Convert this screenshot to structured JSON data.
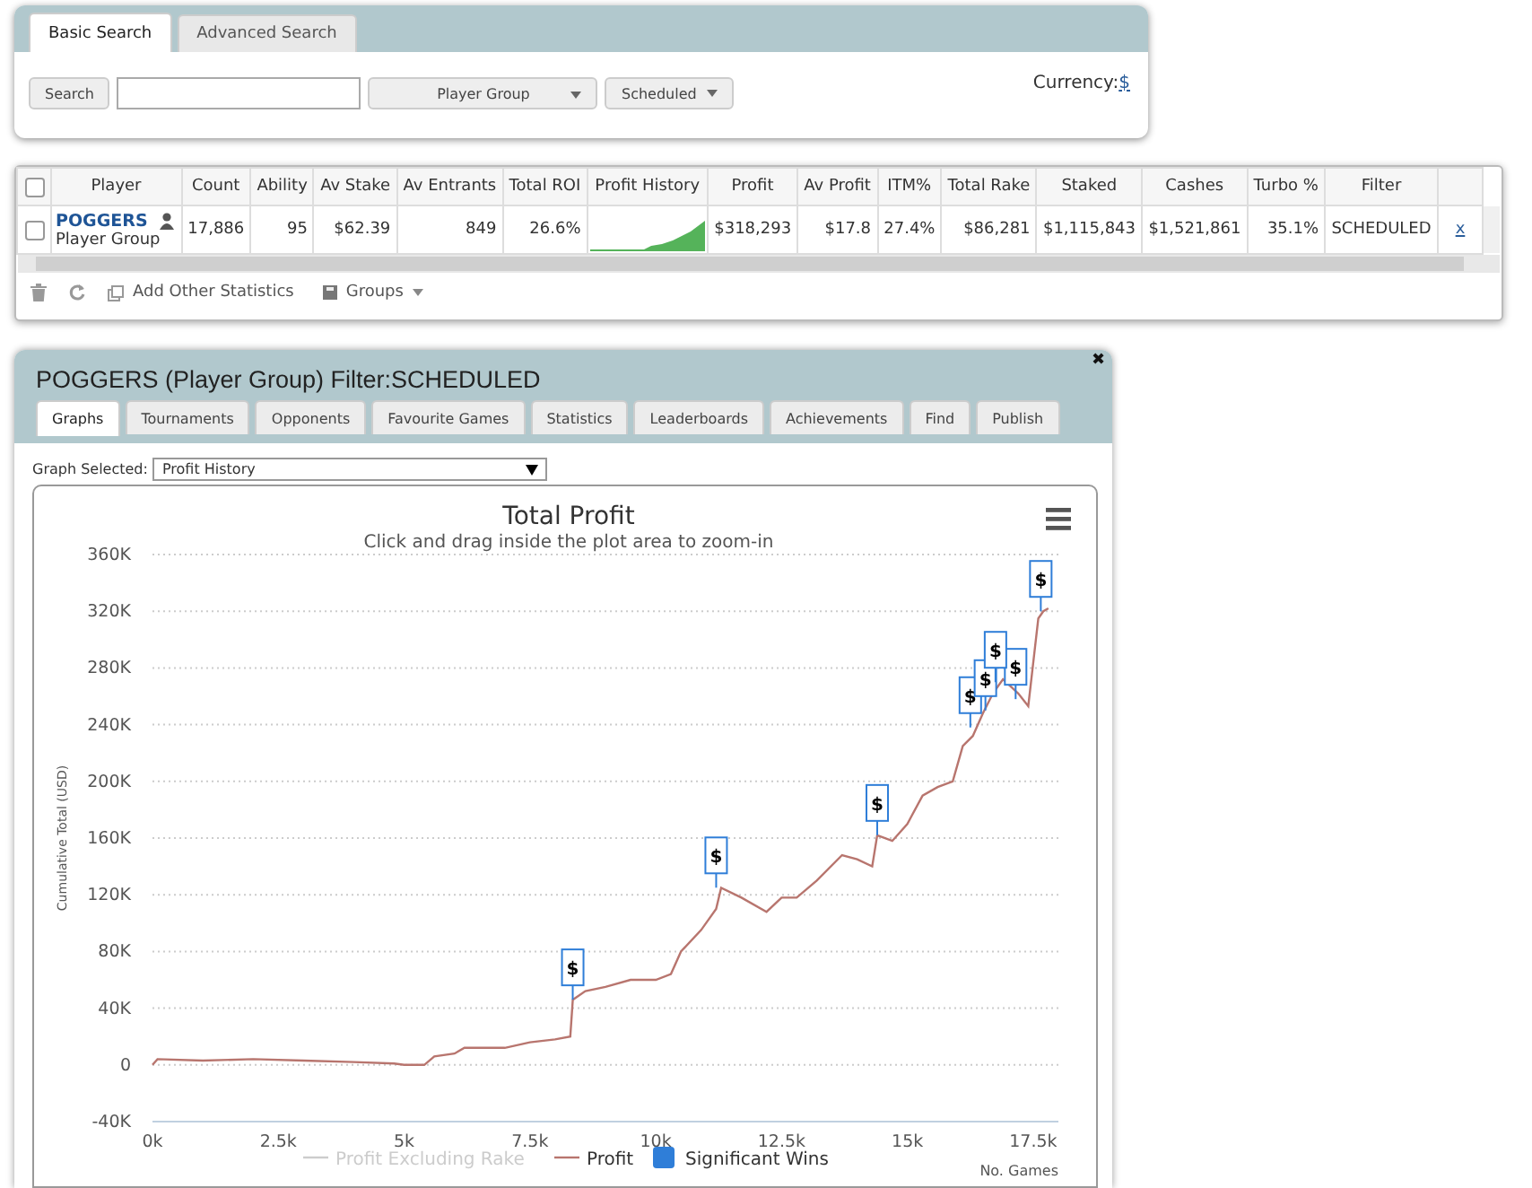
{
  "search_panel": {
    "tabs": [
      {
        "label": "Basic Search",
        "selected": true
      },
      {
        "label": "Advanced Search",
        "selected": false
      }
    ],
    "search_button": "Search",
    "group_dropdown": "Player Group",
    "schedule_dropdown": "Scheduled",
    "currency_label": "Currency:",
    "currency_value": "$"
  },
  "table": {
    "header_checked": false,
    "columns": [
      "Player",
      "Count",
      "Ability",
      "Av Stake",
      "Av Entrants",
      "Total ROI",
      "Profit History",
      "Profit",
      "Av Profit",
      "ITM%",
      "Total Rake",
      "Staked",
      "Cashes",
      "Turbo %",
      "Filter"
    ],
    "rows": [
      {
        "checked": false,
        "cells": [
          {
            "kind": "player",
            "text": "POGGERS",
            "subtitle": "Player Group"
          },
          {
            "kind": "number",
            "text": "17,886"
          },
          {
            "kind": "number",
            "text": "95"
          },
          {
            "kind": "number",
            "text": "$62.39"
          },
          {
            "kind": "number",
            "text": "849"
          },
          {
            "kind": "number",
            "text": "26.6%"
          },
          {
            "kind": "sparkline"
          },
          {
            "kind": "number",
            "text": "$318,293"
          },
          {
            "kind": "number",
            "text": "$17.8"
          },
          {
            "kind": "number",
            "text": "27.4%"
          },
          {
            "kind": "number",
            "text": "$86,281"
          },
          {
            "kind": "number",
            "text": "$1,115,843"
          },
          {
            "kind": "number",
            "text": "$1,521,861"
          },
          {
            "kind": "number",
            "text": "35.1%"
          },
          {
            "kind": "label",
            "text": "SCHEDULED"
          },
          {
            "kind": "link",
            "text": "x"
          }
        ]
      }
    ],
    "add_statistics": "Add Other Statistics",
    "groups": "Groups"
  },
  "detail": {
    "title": "POGGERS (Player Group) Filter:SCHEDULED",
    "close": "✖",
    "tabs": [
      {
        "label": "Graphs",
        "selected": true
      },
      {
        "label": "Tournaments",
        "selected": false
      },
      {
        "label": "Opponents",
        "selected": false
      },
      {
        "label": "Favourite Games",
        "selected": false
      },
      {
        "label": "Statistics",
        "selected": false
      },
      {
        "label": "Leaderboards",
        "selected": false
      },
      {
        "label": "Achievements",
        "selected": false
      },
      {
        "label": "Find",
        "selected": false
      },
      {
        "label": "Publish",
        "selected": false
      }
    ],
    "graph_label": "Graph Selected:",
    "graph_value": "Profit History",
    "subtitle": "Click and drag inside the plot area to zoom-in",
    "legend": [
      {
        "label": "Profit Excluding Rake",
        "visible": false,
        "kind": "line",
        "color": "#cccccc"
      },
      {
        "kind": "series",
        "visible": true
      },
      {
        "label": "Significant Wins",
        "visible": true,
        "kind": "flag",
        "color": "#2f7ed8"
      }
    ],
    "chart_data": {
      "type": "line",
      "title": "Total Profit",
      "xlabel": "No. Games",
      "ylabel": "Cumulative Total (USD)",
      "x": [
        0,
        100,
        1000,
        2000,
        3000,
        4000,
        4800,
        5000,
        5400,
        5600,
        6000,
        6200,
        7000,
        7500,
        8000,
        8300,
        8350,
        8600,
        9000,
        9500,
        10000,
        10300,
        10500,
        10900,
        11200,
        11300,
        11700,
        12200,
        12500,
        12800,
        13200,
        13700,
        14000,
        14300,
        14400,
        14700,
        15000,
        15300,
        15600,
        15900,
        16100,
        16300,
        16500,
        16700,
        16900,
        17200,
        17400,
        17600,
        17700,
        17800
      ],
      "series": [
        {
          "name": "Profit",
          "color": "#b8756e",
          "values": [
            0,
            4000,
            3000,
            4000,
            3000,
            2000,
            1000,
            0,
            0,
            6000,
            8000,
            12000,
            12000,
            16000,
            18000,
            20000,
            46000,
            52000,
            55000,
            60000,
            60000,
            64000,
            80000,
            95000,
            110000,
            125000,
            118000,
            108000,
            118000,
            118000,
            130000,
            148000,
            145000,
            140000,
            162000,
            158000,
            170000,
            190000,
            196000,
            200000,
            225000,
            232000,
            248000,
            262000,
            272000,
            262000,
            253000,
            315000,
            320000,
            322000
          ]
        }
      ],
      "xlim": [
        0,
        18000
      ],
      "ylim": [
        -40000,
        360000
      ],
      "grid": true,
      "xticks": [
        {
          "value": 0,
          "label": "0k"
        },
        {
          "value": 2500,
          "label": "2.5k"
        },
        {
          "value": 5000,
          "label": "5k"
        },
        {
          "value": 7500,
          "label": "7.5k"
        },
        {
          "value": 10000,
          "label": "10k"
        },
        {
          "value": 12500,
          "label": "12.5k"
        },
        {
          "value": 15000,
          "label": "15k"
        },
        {
          "value": 17500,
          "label": "17.5k"
        }
      ],
      "yticks": [
        {
          "value": -40000,
          "label": "-40K"
        },
        {
          "value": 0,
          "label": "0"
        },
        {
          "value": 40000,
          "label": "40K"
        },
        {
          "value": 80000,
          "label": "80K"
        },
        {
          "value": 120000,
          "label": "120K"
        },
        {
          "value": 160000,
          "label": "160K"
        },
        {
          "value": 200000,
          "label": "200K"
        },
        {
          "value": 240000,
          "label": "240K"
        },
        {
          "value": 280000,
          "label": "280K"
        },
        {
          "value": 320000,
          "label": "320K"
        },
        {
          "value": 360000,
          "label": "360K"
        }
      ],
      "annotations": [
        {
          "x": 8350,
          "y": 46000,
          "text": "$"
        },
        {
          "x": 11200,
          "y": 125000,
          "text": "$"
        },
        {
          "x": 14400,
          "y": 162000,
          "text": "$"
        },
        {
          "x": 16250,
          "y": 238000,
          "text": "$"
        },
        {
          "x": 16550,
          "y": 250000,
          "text": "$"
        },
        {
          "x": 17150,
          "y": 258000,
          "text": "$"
        },
        {
          "x": 16750,
          "y": 270000,
          "text": "$"
        },
        {
          "x": 17650,
          "y": 320000,
          "text": "$"
        }
      ]
    }
  }
}
